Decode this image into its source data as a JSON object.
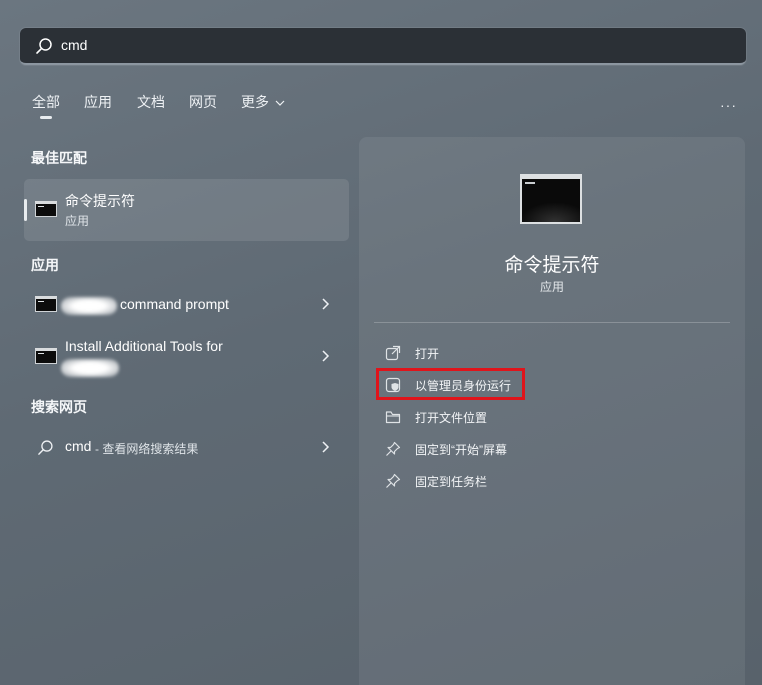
{
  "search": {
    "query": "cmd"
  },
  "tabs": [
    "全部",
    "应用",
    "文档",
    "网页",
    "更多"
  ],
  "more_menu": "···",
  "best_match": {
    "section_title": "最佳匹配",
    "name": "命令提示符",
    "type": "应用"
  },
  "apps": {
    "section_title": "应用",
    "items": [
      {
        "title": "command prompt"
      },
      {
        "title_line1": "Install Additional Tools for"
      }
    ]
  },
  "web": {
    "section_title": "搜索网页",
    "query": "cmd",
    "suffix": " - 查看网络搜索结果"
  },
  "detail": {
    "name": "命令提示符",
    "type": "应用",
    "actions": [
      {
        "label": "打开",
        "icon": "open-external-icon"
      },
      {
        "label": "以管理员身份运行",
        "icon": "shield-icon"
      },
      {
        "label": "打开文件位置",
        "icon": "folder-icon"
      },
      {
        "label": "固定到“开始”屏幕",
        "icon": "pin-icon"
      },
      {
        "label": "固定到任务栏",
        "icon": "pin-icon"
      }
    ]
  },
  "colors": {
    "highlight_border": "#e0141b"
  }
}
